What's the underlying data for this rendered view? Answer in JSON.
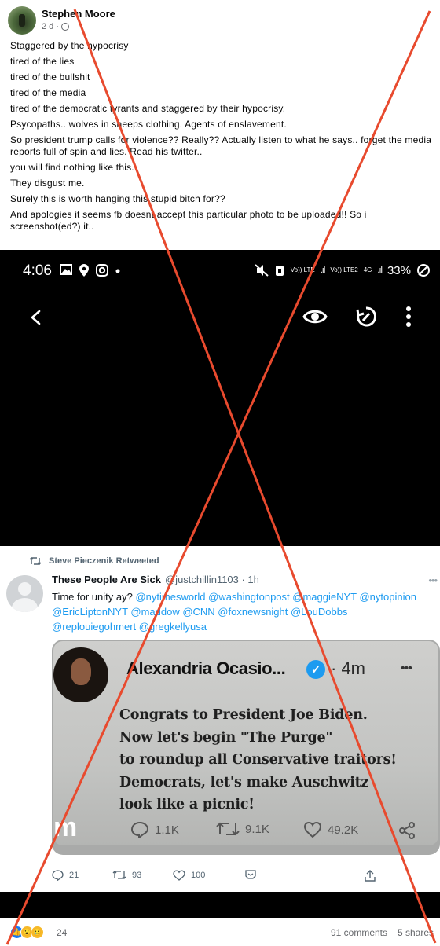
{
  "post": {
    "author": "Stephen Moore",
    "time": "2 d ·",
    "lines": [
      "Staggered by the hypocrisy",
      "tired of the lies",
      "tired of the bullshit",
      "tired of the media",
      "tired of the democratic tyrants and staggered by their hypocrisy.",
      "Psycopaths.. wolves in sheeps clothing. Agents of enslavement.",
      "So president trump calls for violence?? Really?? Actually listen to what he says.. forget the media reports full of spin and lies. Read his twitter..",
      "you will find nothing like this.",
      "They disgust me.",
      "Surely this is worth hanging this stupid bitch for??",
      "And apologies it seems fb doesnt accept this particular photo to be uploaded!! So i screenshot(ed?) it.."
    ]
  },
  "status_bar": {
    "time": "4:06",
    "volte1": "Vo)) LTE",
    "volte2": "Vo)) LTE2",
    "net": "4G",
    "battery": "33%"
  },
  "tweet": {
    "retweet_label": "Steve Pieczenik Retweeted",
    "name": "These People Are Sick",
    "handle": "@justchillin1103 · 1h",
    "more": "•••",
    "body_prefix": "Time for unity ay? ",
    "mentions": "@nytimesworld @washingtonpost @maggieNYT @nytopinion @EricLiptonNYT @maddow @CNN @foxnewsnight @LouDobbs @replouiegohmert @gregkellyusa",
    "actions": {
      "replies": "21",
      "retweets": "93",
      "likes": "100"
    }
  },
  "embedded_card": {
    "name": "Alexandria Ocasio...",
    "verified": "✓",
    "time": "· 4m",
    "more": "•••",
    "lines": [
      "Congrats to President Joe Biden.",
      "Now let's begin \"The Purge\"",
      "to roundup all Conservative traitors!",
      "Democrats, let's make Auschwitz",
      "look like a picnic!"
    ],
    "logo": "m",
    "replies": "1.1K",
    "retweets": "9.1K",
    "likes": "49.2K"
  },
  "footer": {
    "reaction_count": "24",
    "comments": "91 comments",
    "shares": "5 shares"
  },
  "colors": {
    "accent": "#1d9bf0",
    "cross": "#e84a2e",
    "fb_like": "#1877f2"
  }
}
